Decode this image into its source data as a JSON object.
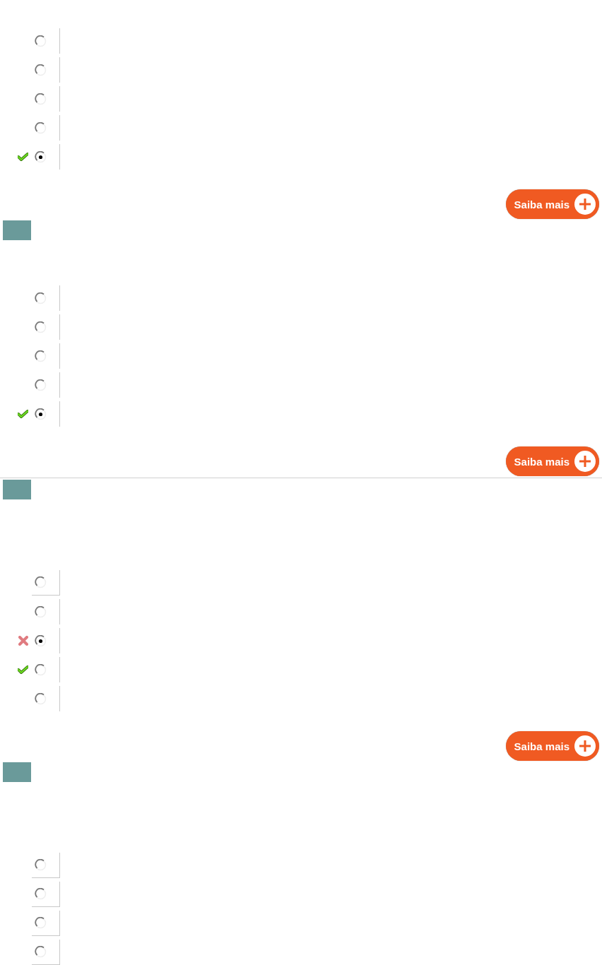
{
  "questions": [
    {
      "header": false,
      "divider": false,
      "options": [
        {
          "selected": false,
          "kind": "plain"
        },
        {
          "selected": false,
          "kind": "plain"
        },
        {
          "selected": false,
          "kind": "plain"
        },
        {
          "selected": false,
          "kind": "plain"
        },
        {
          "selected": true,
          "kind": "correct"
        }
      ],
      "button": "Saiba mais"
    },
    {
      "header": true,
      "divider": false,
      "options": [
        {
          "selected": false,
          "kind": "plain"
        },
        {
          "selected": false,
          "kind": "plain"
        },
        {
          "selected": false,
          "kind": "plain"
        },
        {
          "selected": false,
          "kind": "plain"
        },
        {
          "selected": true,
          "kind": "correct"
        }
      ],
      "button": "Saiba mais"
    },
    {
      "header": true,
      "divider": true,
      "options": [
        {
          "selected": false,
          "kind": "plain"
        },
        {
          "selected": false,
          "kind": "plain"
        },
        {
          "selected": true,
          "kind": "wrong"
        },
        {
          "selected": false,
          "kind": "correct"
        },
        {
          "selected": false,
          "kind": "plain"
        }
      ],
      "button": "Saiba mais"
    },
    {
      "header": true,
      "divider": false,
      "options": [
        {
          "selected": false,
          "kind": "plain"
        },
        {
          "selected": false,
          "kind": "plain"
        },
        {
          "selected": false,
          "kind": "plain"
        },
        {
          "selected": false,
          "kind": "plain"
        }
      ]
    }
  ]
}
